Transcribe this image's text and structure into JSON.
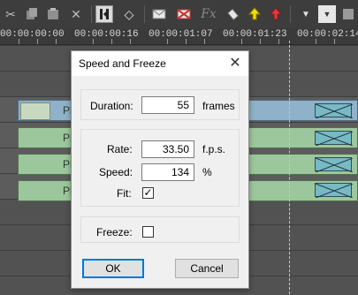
{
  "toolbar": {
    "icons": [
      "scissors-icon",
      "copy-icon",
      "paste-icon",
      "delete-icon",
      "split-icon",
      "marker-icon",
      "envelope-icon",
      "mute-envelope-icon",
      "fx-icon",
      "tag-icon",
      "arrow-up-icon",
      "arrow-down-icon",
      "chevron-down-icon",
      "dropdown-icon",
      "settings-icon"
    ],
    "fx_label": "Fx"
  },
  "ruler": {
    "timecodes": [
      "00:00:00:00",
      "00:00:00:16",
      "00:00:01:07",
      "00:00:01:23",
      "00:00:02:14"
    ]
  },
  "tracks": {
    "clip_label": "Pl"
  },
  "dialog": {
    "title": "Speed and Freeze",
    "duration_label": "Duration:",
    "duration_value": "55",
    "duration_unit": "frames",
    "rate_label": "Rate:",
    "rate_value": "33.50",
    "rate_unit": "f.p.s.",
    "speed_label": "Speed:",
    "speed_value": "134",
    "speed_unit": "%",
    "fit_label": "Fit:",
    "fit_checked": true,
    "freeze_label": "Freeze:",
    "freeze_checked": false,
    "ok_label": "OK",
    "cancel_label": "Cancel",
    "check_mark": "✓"
  }
}
